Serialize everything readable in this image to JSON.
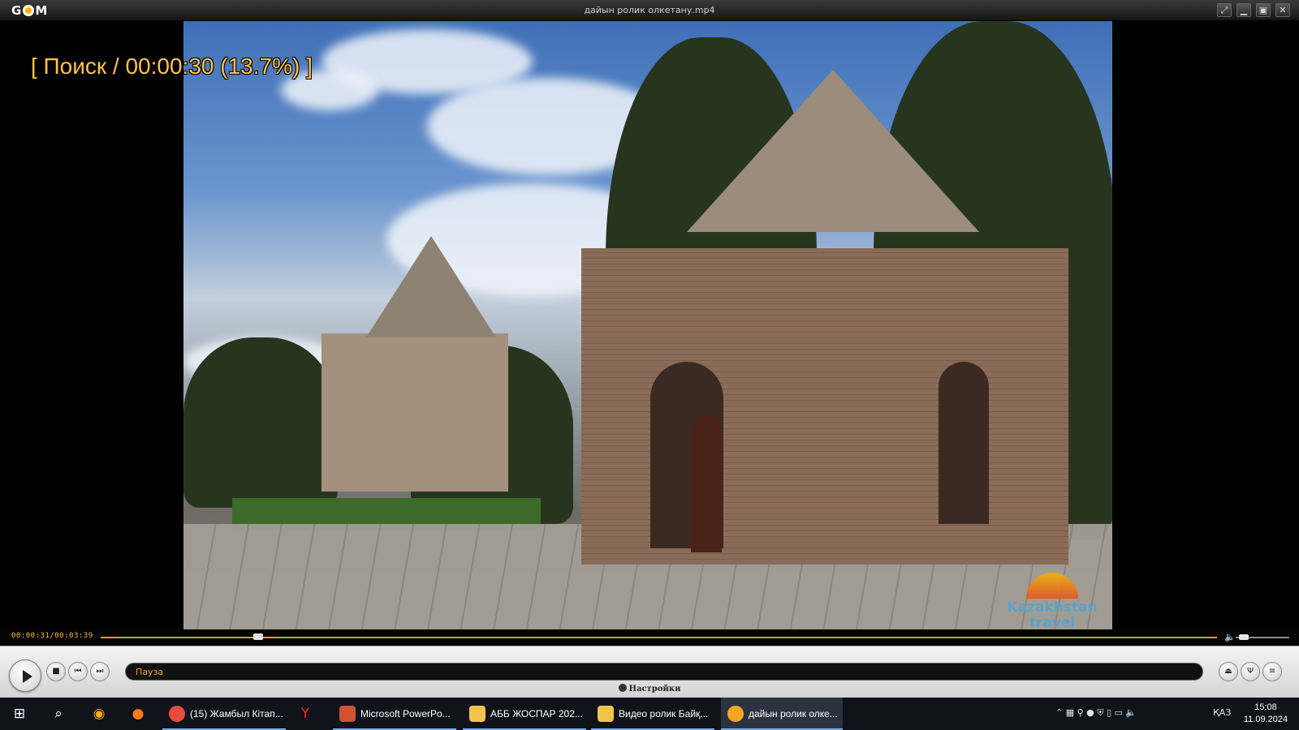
{
  "window": {
    "app_logo": "GOM",
    "title": "дайын ролик олкетану.mp4",
    "controls": [
      "restore-icon",
      "minimize-icon",
      "maximize-icon",
      "close-icon"
    ]
  },
  "video": {
    "osd_text": "[ Поиск / 00:00:30 (13.7%) ]",
    "watermark_line1": "Kazakhstan",
    "watermark_line2": "travel"
  },
  "seekbar": {
    "time_display": "00:00:31/00:03:39",
    "progress_percent": 13.7,
    "volume_level": 0.15
  },
  "controls": {
    "status_text": "Пауза",
    "settings_label": "Настройки",
    "buttons": [
      "play-icon",
      "stop-icon",
      "previous-icon",
      "next-icon",
      "eject-icon",
      "playlist-icon",
      "menu-icon"
    ]
  },
  "taskbar": {
    "tasks": [
      {
        "label": "(15) Жамбыл Кітап...",
        "icon": "chrome-icon",
        "color": "#e74c3c"
      },
      {
        "label": "Microsoft PowerPo...",
        "icon": "powerpoint-icon",
        "color": "#d35230"
      },
      {
        "label": "АББ ЖОСПАР 202...",
        "icon": "folder-icon",
        "color": "#f3c44a"
      },
      {
        "label": "Видео ролик Байқ...",
        "icon": "folder-icon",
        "color": "#f3c44a"
      },
      {
        "label": "дайын ролик олке...",
        "icon": "gom-icon",
        "color": "#f5a623",
        "active": true
      }
    ],
    "lang": "ҚАЗ",
    "time": "15:08",
    "date": "11.09.2024"
  }
}
